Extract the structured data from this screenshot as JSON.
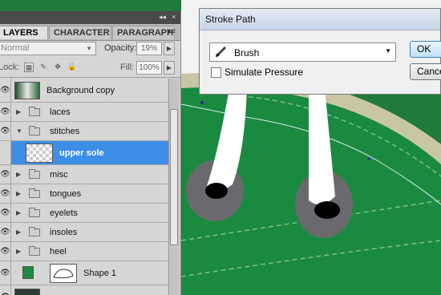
{
  "layers_panel": {
    "tabs": [
      {
        "label": "LAYERS",
        "active": true
      },
      {
        "label": "CHARACTER",
        "active": false
      },
      {
        "label": "PARAGRAPH",
        "active": false
      }
    ],
    "blend_mode": "Normal",
    "opacity_label": "Opacity:",
    "opacity_value": "19%",
    "lock_label": "Lock:",
    "fill_label": "Fill:",
    "fill_value": "100%",
    "layers": [
      {
        "name": "Background copy",
        "type": "image",
        "visible": true
      },
      {
        "name": "laces",
        "type": "group",
        "expanded": false,
        "visible": true
      },
      {
        "name": "stitches",
        "type": "group",
        "expanded": true,
        "visible": true
      },
      {
        "name": "upper sole",
        "type": "layer",
        "selected": true,
        "visible": false
      },
      {
        "name": "misc",
        "type": "group",
        "expanded": false,
        "visible": true
      },
      {
        "name": "tongues",
        "type": "group",
        "expanded": false,
        "visible": true
      },
      {
        "name": "eyelets",
        "type": "group",
        "expanded": false,
        "visible": true
      },
      {
        "name": "insoles",
        "type": "group",
        "expanded": false,
        "visible": true
      },
      {
        "name": "heel",
        "type": "group",
        "expanded": false,
        "visible": true
      },
      {
        "name": "Shape 1",
        "type": "shape",
        "visible": true
      }
    ]
  },
  "dialog": {
    "title": "Stroke Path",
    "tool": "Brush",
    "simulate_pressure_label": "Simulate Pressure",
    "simulate_pressure_checked": false,
    "ok_label": "OK",
    "cancel_label": "Cancel"
  },
  "colors": {
    "shoe_green": "#1d8a3e",
    "selection_blue": "#3d8ee6",
    "panel_gray": "#d6d6d6"
  }
}
